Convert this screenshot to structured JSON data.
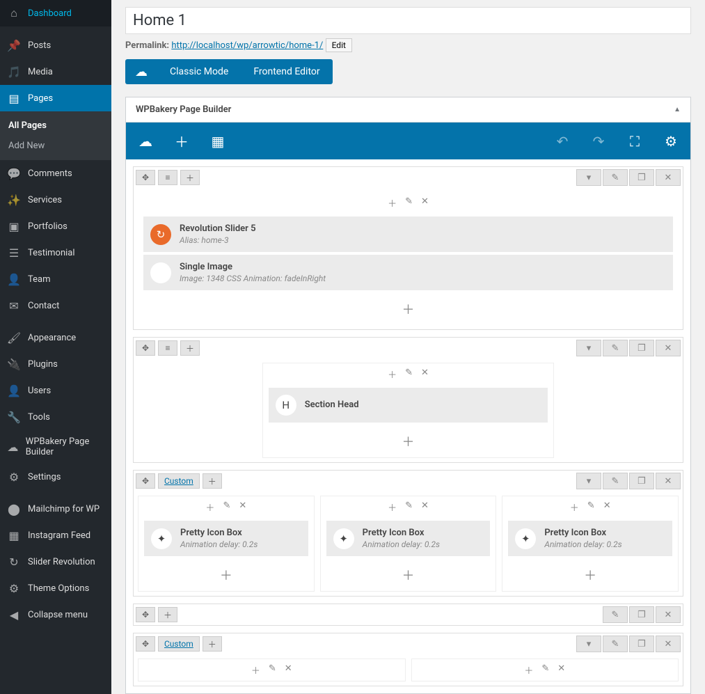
{
  "sidebar": {
    "items": [
      {
        "icon": "dashboard",
        "label": "Dashboard"
      },
      {
        "icon": "pin",
        "label": "Posts"
      },
      {
        "icon": "media",
        "label": "Media"
      },
      {
        "icon": "pages",
        "label": "Pages",
        "active": true
      },
      {
        "icon": "comment",
        "label": "Comments"
      },
      {
        "icon": "wand",
        "label": "Services"
      },
      {
        "icon": "portfolio",
        "label": "Portfolios"
      },
      {
        "icon": "testimonial",
        "label": "Testimonial"
      },
      {
        "icon": "user",
        "label": "Team"
      },
      {
        "icon": "mail",
        "label": "Contact"
      },
      {
        "icon": "appearance",
        "label": "Appearance"
      },
      {
        "icon": "plugins",
        "label": "Plugins"
      },
      {
        "icon": "users",
        "label": "Users"
      },
      {
        "icon": "tools",
        "label": "Tools"
      },
      {
        "icon": "wpb",
        "label": "WPBakery Page Builder"
      },
      {
        "icon": "settings",
        "label": "Settings"
      },
      {
        "icon": "mc",
        "label": "Mailchimp for WP"
      },
      {
        "icon": "ig",
        "label": "Instagram Feed"
      },
      {
        "icon": "slider",
        "label": "Slider Revolution"
      },
      {
        "icon": "theme",
        "label": "Theme Options"
      },
      {
        "icon": "collapse",
        "label": "Collapse menu"
      }
    ],
    "submenu": [
      {
        "label": "All Pages",
        "active": true
      },
      {
        "label": "Add New"
      }
    ]
  },
  "title": "Home 1",
  "permalink": {
    "label": "Permalink:",
    "base": "http://localhost/wp/arrowtic/",
    "slug": "home-1",
    "suffix": "/",
    "edit": "Edit"
  },
  "modes": {
    "classic": "Classic Mode",
    "frontend": "Frontend Editor"
  },
  "panel_title": "WPBakery Page Builder",
  "elements": {
    "rev": {
      "title": "Revolution Slider 5",
      "sub": "Alias: home-3"
    },
    "img": {
      "title": "Single Image",
      "sub": "Image: 1348  CSS Animation: fadeInRight"
    },
    "head": {
      "title": "Section Head",
      "letter": "H"
    },
    "box": {
      "title": "Pretty Icon Box",
      "sub": "Animation delay: 0.2s"
    },
    "custom": "Custom"
  }
}
